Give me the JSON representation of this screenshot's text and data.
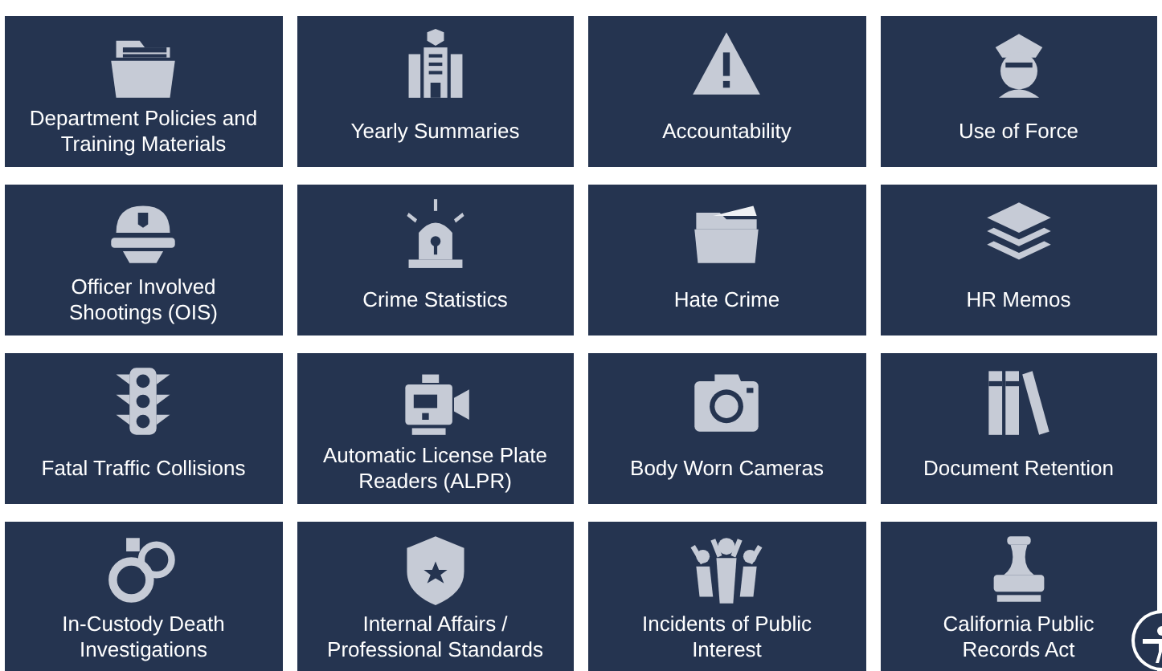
{
  "tiles": [
    {
      "label": "Department Policies and Training Materials"
    },
    {
      "label": "Yearly Summaries"
    },
    {
      "label": "Accountability"
    },
    {
      "label": "Use of Force"
    },
    {
      "label": "Officer Involved Shootings (OIS)"
    },
    {
      "label": "Crime Statistics"
    },
    {
      "label": "Hate Crime"
    },
    {
      "label": "HR Memos"
    },
    {
      "label": "Fatal Traffic Collisions"
    },
    {
      "label": "Automatic License Plate Readers (ALPR)"
    },
    {
      "label": "Body Worn Cameras"
    },
    {
      "label": "Document Retention"
    },
    {
      "label": "In-Custody Death Investigations"
    },
    {
      "label": "Internal Affairs / Professional Standards"
    },
    {
      "label": "Incidents of Public Interest"
    },
    {
      "label": "California Public Records Act"
    }
  ]
}
